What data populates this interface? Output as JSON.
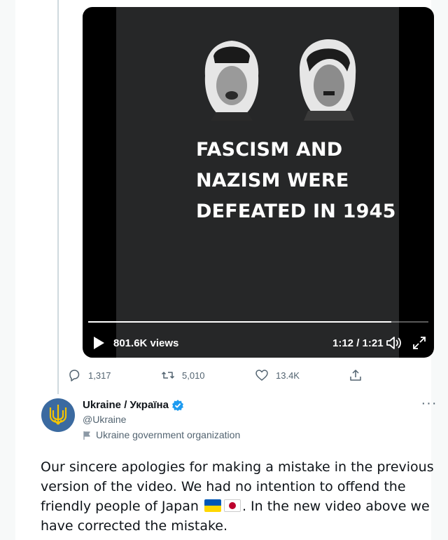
{
  "video": {
    "headline_lines": [
      "FASCISM AND",
      "NAZISM WERE",
      "DEFEATED IN 1945"
    ],
    "views": "801.6K views",
    "time": "1:12 / 1:21",
    "progress_fraction": 0.89
  },
  "actions": {
    "replies": "1,317",
    "retweets": "5,010",
    "likes": "13.4K"
  },
  "tweet": {
    "display_name": "Ukraine / Україна",
    "handle": "@Ukraine",
    "label": "Ukraine government organization",
    "text_part1": "Our sincere apologies for making a mistake in the previous version of the video. We had no intention to offend the friendly people of Japan",
    "text_part2": ". In the new video above we have corrected the mistake."
  },
  "icons": [
    "play-icon",
    "volume-icon",
    "fullscreen-icon",
    "reply-icon",
    "retweet-icon",
    "like-icon",
    "share-icon",
    "verified-icon",
    "more-icon",
    "flag-icon",
    "ukraine-flag-emoji",
    "japan-flag-emoji"
  ],
  "colors": {
    "verified": "#1d9bf0",
    "muted": "#536471",
    "text": "#0f1419"
  }
}
